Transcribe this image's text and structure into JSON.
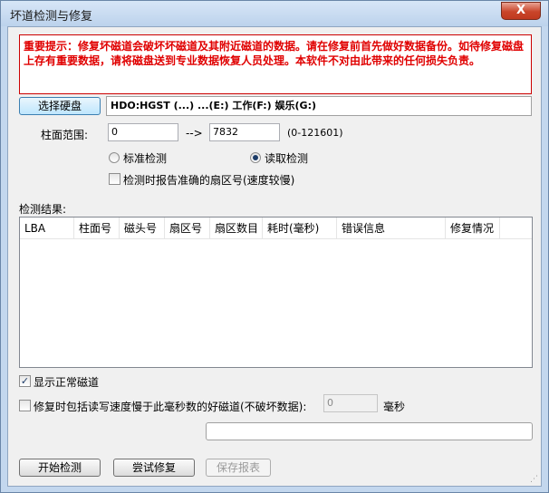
{
  "window": {
    "title": "坏道检测与修复",
    "close_glyph": "X"
  },
  "warning": {
    "text": "重要提示：修复坏磁道会破坏坏磁道及其附近磁道的数据。请在修复前首先做好数据备份。如待修复磁盘上存有重要数据，请将磁盘送到专业数据恢复人员处理。本软件不对由此带来的任何损失负责。"
  },
  "disk": {
    "select_label": "选择硬盘",
    "info_text": "HDO:HGST                                    (...)          ...(E:)  工作(F:)  娱乐(G:)"
  },
  "range": {
    "label": "柱面范围:",
    "start_value": "0",
    "arrow": "-->",
    "end_value": "7832",
    "hint": "(0-121601)"
  },
  "mode": {
    "standard_label": "标准检测",
    "read_label": "读取检测",
    "selected": "read"
  },
  "accurate_sector": {
    "label": "检测时报告准确的扇区号(速度较慢)",
    "checked": false
  },
  "results": {
    "label": "检测结果:",
    "columns": [
      "LBA",
      "柱面号",
      "磁头号",
      "扇区号",
      "扇区数目",
      "耗时(毫秒)",
      "错误信息",
      "修复情况"
    ],
    "rows": []
  },
  "show_normal": {
    "label": "显示正常磁道",
    "checked": true
  },
  "slow_repair": {
    "label": "修复时包括读写速度慢于此毫秒数的好磁道(不破坏数据):",
    "value": "0",
    "unit": "毫秒",
    "checked": false
  },
  "actions": {
    "start_label": "开始检测",
    "try_repair_label": "尝试修复",
    "save_report_label": "保存报表"
  },
  "colors": {
    "warning_red": "#e00000",
    "title_bar": "#c3d7ee"
  }
}
